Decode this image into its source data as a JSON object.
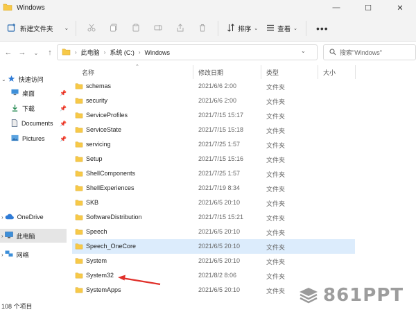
{
  "window": {
    "title": "Windows",
    "minimize": "—",
    "maximize": "☐",
    "close": "✕"
  },
  "toolbar": {
    "new_label": "新建文件夹",
    "sort_label": "排序",
    "view_label": "查看",
    "more_label": "•••"
  },
  "address": {
    "crumbs": [
      "此电脑",
      "系统 (C:)",
      "Windows"
    ],
    "search_placeholder": "搜索\"Windows\""
  },
  "sidebar": {
    "items": [
      {
        "label": "快速访问",
        "icon": "star-icon",
        "pinned": false
      },
      {
        "label": "桌面",
        "icon": "desktop-icon",
        "pinned": true
      },
      {
        "label": "下载",
        "icon": "download-icon",
        "pinned": true
      },
      {
        "label": "Documents",
        "icon": "documents-icon",
        "pinned": true
      },
      {
        "label": "Pictures",
        "icon": "pictures-icon",
        "pinned": true
      },
      {
        "label": "OneDrive",
        "icon": "cloud-icon",
        "pinned": false
      },
      {
        "label": "此电脑",
        "icon": "computer-icon",
        "pinned": false
      },
      {
        "label": "网络",
        "icon": "network-icon",
        "pinned": false
      }
    ]
  },
  "columns": {
    "name": "名称",
    "date": "修改日期",
    "type": "类型",
    "size": "大小"
  },
  "files": [
    {
      "name": "schemas",
      "date": "2021/6/6 2:00",
      "type": "文件夹"
    },
    {
      "name": "security",
      "date": "2021/6/6 2:00",
      "type": "文件夹"
    },
    {
      "name": "ServiceProfiles",
      "date": "2021/7/15 15:17",
      "type": "文件夹"
    },
    {
      "name": "ServiceState",
      "date": "2021/7/15 15:18",
      "type": "文件夹"
    },
    {
      "name": "servicing",
      "date": "2021/7/25 1:57",
      "type": "文件夹"
    },
    {
      "name": "Setup",
      "date": "2021/7/15 15:16",
      "type": "文件夹"
    },
    {
      "name": "ShellComponents",
      "date": "2021/7/25 1:57",
      "type": "文件夹"
    },
    {
      "name": "ShellExperiences",
      "date": "2021/7/19 8:34",
      "type": "文件夹"
    },
    {
      "name": "SKB",
      "date": "2021/6/5 20:10",
      "type": "文件夹"
    },
    {
      "name": "SoftwareDistribution",
      "date": "2021/7/15 15:21",
      "type": "文件夹"
    },
    {
      "name": "Speech",
      "date": "2021/6/5 20:10",
      "type": "文件夹"
    },
    {
      "name": "Speech_OneCore",
      "date": "2021/6/5 20:10",
      "type": "文件夹"
    },
    {
      "name": "System",
      "date": "2021/6/5 20:10",
      "type": "文件夹"
    },
    {
      "name": "System32",
      "date": "2021/8/2 8:06",
      "type": "文件夹"
    },
    {
      "name": "SystemApps",
      "date": "2021/6/5 20:10",
      "type": "文件夹"
    }
  ],
  "status": {
    "count": "108 个项目"
  },
  "watermark": {
    "text": "861PPT"
  },
  "colors": {
    "folder": "#f7c948",
    "selection": "#dcecfc",
    "sidebar_selected": "#e5e5e5",
    "annotation": "#e0302a"
  }
}
